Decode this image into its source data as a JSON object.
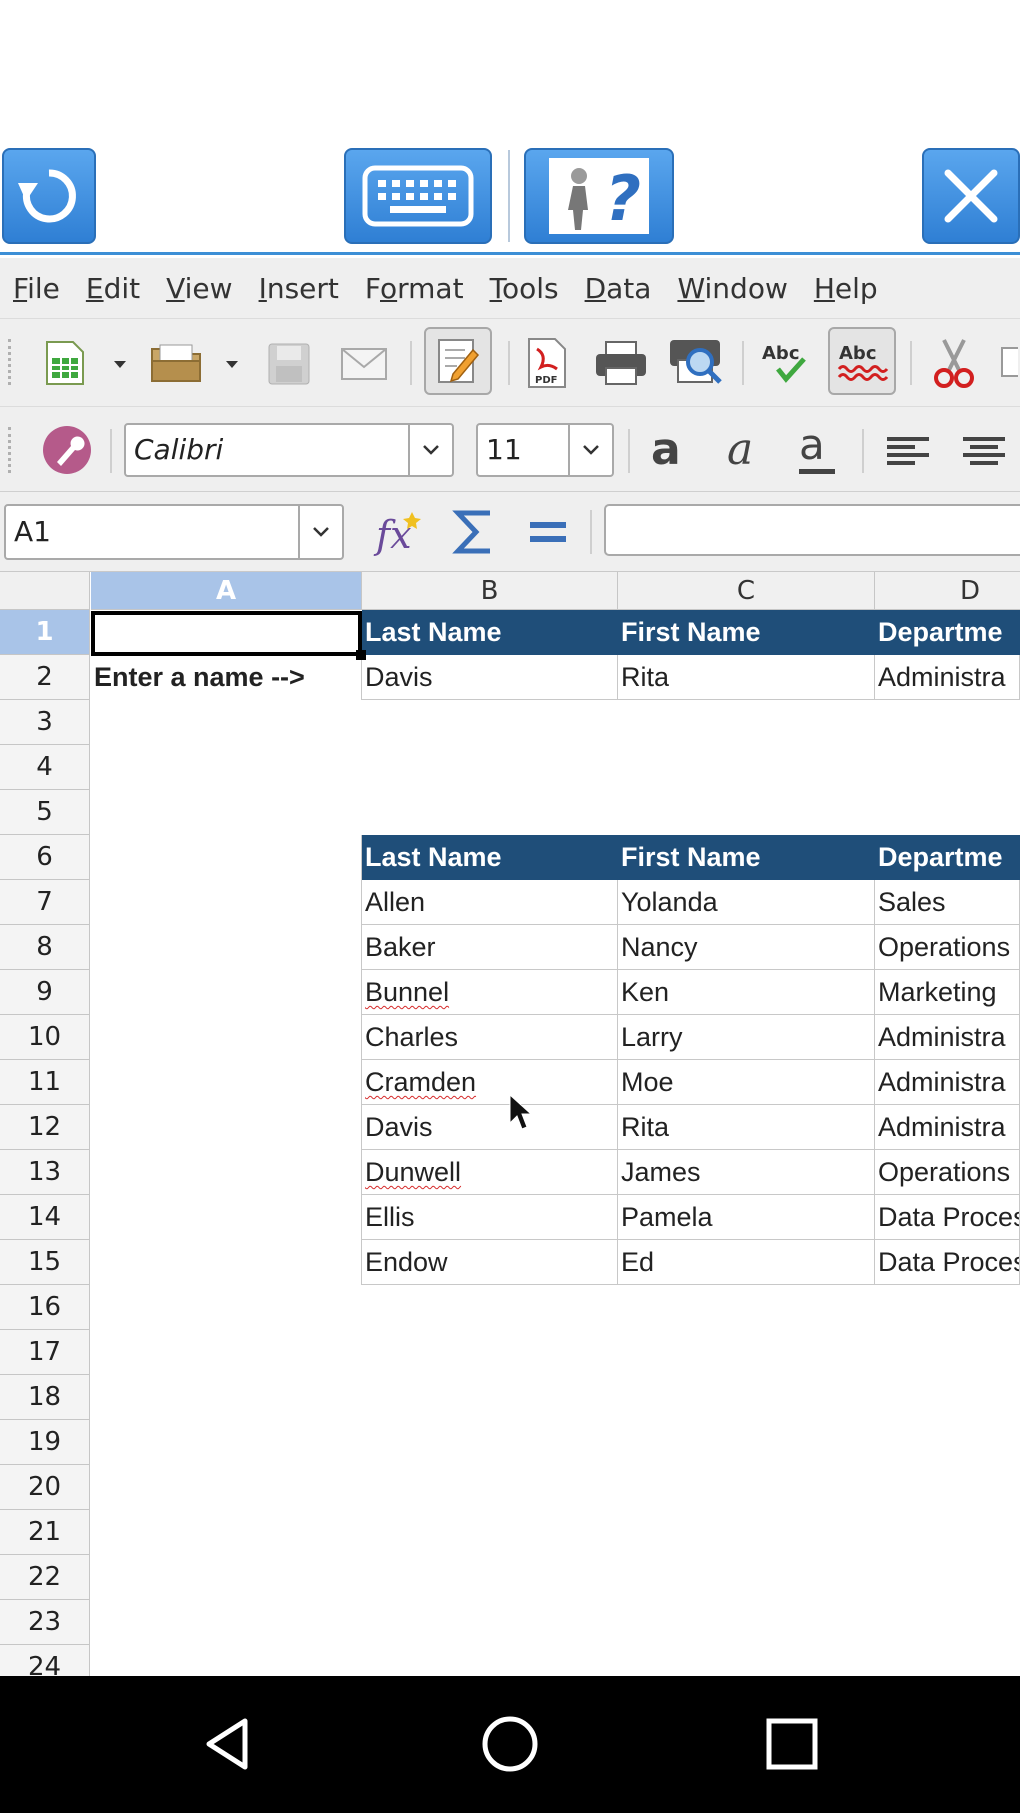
{
  "menu": [
    "File",
    "Edit",
    "View",
    "Insert",
    "Format",
    "Tools",
    "Data",
    "Window",
    "Help"
  ],
  "menu_mnemonics": [
    "F",
    "E",
    "V",
    "I",
    "o",
    "T",
    "D",
    "W",
    "H"
  ],
  "font": {
    "name": "Calibri",
    "size": "11"
  },
  "name_box": "A1",
  "formula_value": "",
  "columns": [
    "A",
    "B",
    "C",
    "D"
  ],
  "selected_column": "A",
  "rows": [
    "1",
    "2",
    "3",
    "4",
    "5",
    "6",
    "7",
    "8",
    "9",
    "10",
    "11",
    "12",
    "13",
    "14",
    "15",
    "16",
    "17",
    "18",
    "19",
    "20",
    "21",
    "22",
    "23",
    "24"
  ],
  "selected_row": "1",
  "header_row": {
    "last": "Last Name",
    "first": "First Name",
    "dept": "Departme"
  },
  "row2": {
    "a": "Enter a name -->",
    "b": "Davis",
    "c": "Rita",
    "d": "Administra"
  },
  "table": [
    {
      "last": "Allen",
      "first": "Yolanda",
      "dept": "Sales"
    },
    {
      "last": "Baker",
      "first": "Nancy",
      "dept": "Operations"
    },
    {
      "last": "Bunnel",
      "first": "Ken",
      "dept": "Marketing"
    },
    {
      "last": "Charles",
      "first": "Larry",
      "dept": "Administra"
    },
    {
      "last": "Cramden",
      "first": "Moe",
      "dept": "Administra"
    },
    {
      "last": "Davis",
      "first": "Rita",
      "dept": "Administra"
    },
    {
      "last": "Dunwell",
      "first": "James",
      "dept": "Operations"
    },
    {
      "last": "Ellis",
      "first": "Pamela",
      "dept": "Data Proces"
    },
    {
      "last": "Endow",
      "first": "Ed",
      "dept": "Data Proces"
    }
  ],
  "spell_flagged": [
    "Bunnel",
    "Cramden",
    "Dunwell"
  ],
  "icons": {
    "top": [
      "refresh-icon",
      "keyboard-icon",
      "help-icon",
      "close-icon"
    ],
    "toolbar": [
      "new-spreadsheet-icon",
      "open-folder-icon",
      "save-icon",
      "email-icon",
      "edit-document-icon",
      "export-pdf-icon",
      "print-icon",
      "print-preview-icon",
      "spellcheck-icon",
      "autospellcheck-icon",
      "cut-icon"
    ],
    "format": [
      "styles-icon",
      "bold-icon",
      "italic-icon",
      "underline-icon",
      "align-left-icon",
      "align-center-icon"
    ],
    "formula": [
      "function-wizard-icon",
      "sum-icon",
      "equals-icon"
    ],
    "nav": [
      "back-icon",
      "home-icon",
      "recents-icon"
    ]
  },
  "colors": {
    "accent": "#3c8fd6",
    "header_fill": "#1f4e79",
    "selection": "#a9c4e8"
  }
}
